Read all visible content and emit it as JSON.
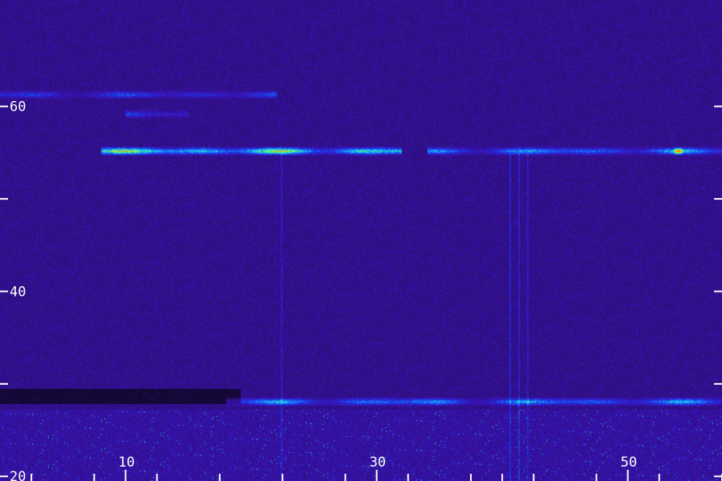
{
  "chart_data": {
    "type": "heatmap",
    "title": "",
    "xlabel": "",
    "ylabel": "",
    "xlim": [
      0,
      57.5
    ],
    "ylim": [
      19.5,
      71.5
    ],
    "x_ticks": [
      {
        "value": 2.5,
        "label": ""
      },
      {
        "value": 7.5,
        "label": ""
      },
      {
        "value": 10,
        "label": "10"
      },
      {
        "value": 12.5,
        "label": ""
      },
      {
        "value": 17.5,
        "label": ""
      },
      {
        "value": 22.5,
        "label": ""
      },
      {
        "value": 27.5,
        "label": ""
      },
      {
        "value": 30,
        "label": "30"
      },
      {
        "value": 32.5,
        "label": ""
      },
      {
        "value": 37.5,
        "label": ""
      },
      {
        "value": 40,
        "label": ""
      },
      {
        "value": 42.5,
        "label": ""
      },
      {
        "value": 47.5,
        "label": ""
      },
      {
        "value": 50,
        "label": "50"
      },
      {
        "value": 52.5,
        "label": ""
      },
      {
        "value": 57.5,
        "label": ""
      }
    ],
    "y_ticks": [
      {
        "value": 20,
        "label": "20"
      },
      {
        "value": 30,
        "label": ""
      },
      {
        "value": 40,
        "label": "40"
      },
      {
        "value": 50,
        "label": ""
      },
      {
        "value": 60,
        "label": "60"
      }
    ],
    "colormap": [
      "#000000",
      "#2a0f6e",
      "#3a10b0",
      "#2030e0",
      "#1a70ff",
      "#18d0f0",
      "#30ff90",
      "#e6f020",
      "#ff9000"
    ],
    "features": [
      {
        "kind": "horizontal_band",
        "y": 55.2,
        "x_range": [
          8,
          32
        ],
        "intensity": 1.0
      },
      {
        "kind": "horizontal_band",
        "y": 55.2,
        "x_range": [
          34,
          57.5
        ],
        "intensity": 0.6
      },
      {
        "kind": "horizontal_band",
        "y": 61.3,
        "x_range": [
          0,
          22
        ],
        "intensity": 0.35
      },
      {
        "kind": "horizontal_band",
        "y": 59.2,
        "x_range": [
          10,
          15
        ],
        "intensity": 0.3
      },
      {
        "kind": "horizontal_band",
        "y": 28.1,
        "x_range": [
          18,
          57.5
        ],
        "intensity": 0.6
      },
      {
        "kind": "vertical_line",
        "x": 22.4,
        "y_range": [
          19.5,
          55
        ],
        "intensity": 0.35
      },
      {
        "kind": "vertical_line",
        "x": 40.6,
        "y_range": [
          19.5,
          55
        ],
        "intensity": 0.45
      },
      {
        "kind": "vertical_line",
        "x": 41.3,
        "y_range": [
          19.5,
          55
        ],
        "intensity": 0.45
      },
      {
        "kind": "vertical_line",
        "x": 42.0,
        "y_range": [
          19.5,
          55
        ],
        "intensity": 0.4
      },
      {
        "kind": "blob",
        "x": 54.0,
        "y": 55.2,
        "intensity": 0.8
      }
    ]
  }
}
